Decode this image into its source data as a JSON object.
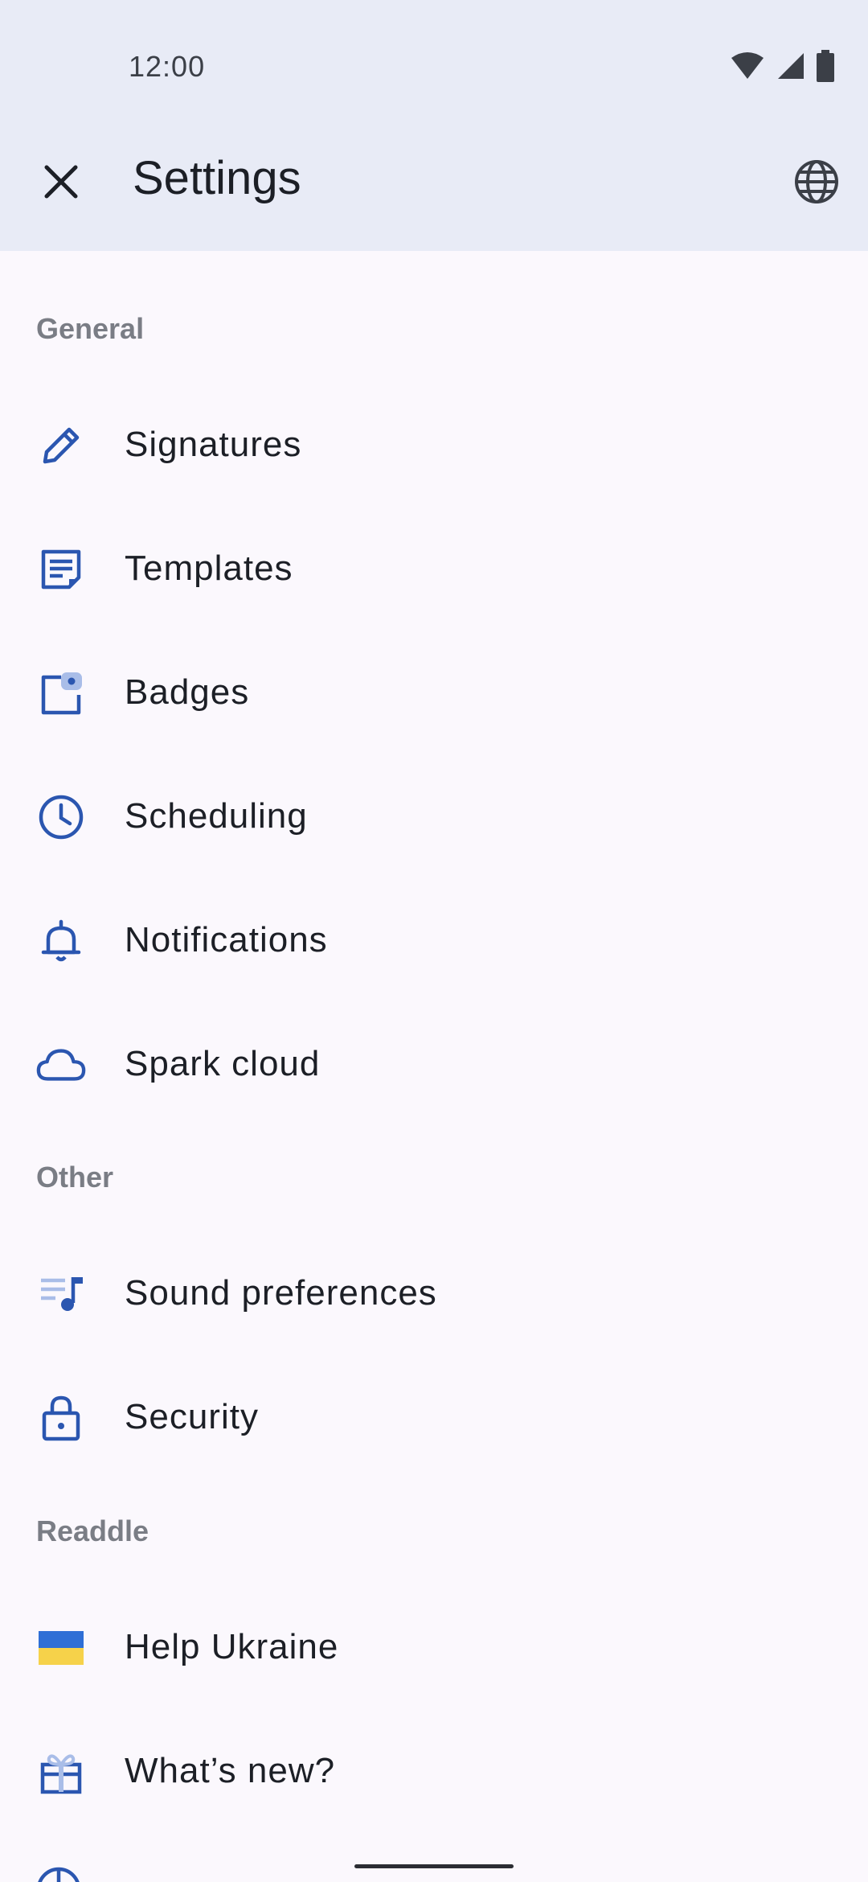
{
  "status": {
    "time": "12:00"
  },
  "header": {
    "title": "Settings"
  },
  "sections": {
    "general": "General",
    "other": "Other",
    "readdle": "Readdle"
  },
  "items": {
    "signatures": "Signatures",
    "templates": "Templates",
    "badges": "Badges",
    "scheduling": "Scheduling",
    "notifications": "Notifications",
    "spark_cloud": "Spark cloud",
    "sound_preferences": "Sound preferences",
    "security": "Security",
    "help_ukraine": "Help Ukraine",
    "whats_new": "What’s new?"
  },
  "icons": {
    "signatures": "pencil-icon",
    "templates": "document-icon",
    "badges": "badge-icon",
    "scheduling": "clock-icon",
    "notifications": "bell-icon",
    "spark_cloud": "cloud-icon",
    "sound_preferences": "music-list-icon",
    "security": "lock-icon",
    "help_ukraine": "ukraine-flag-icon",
    "whats_new": "gift-icon"
  },
  "colors": {
    "accent": "#2b56b0",
    "accent_light": "#a9bde8",
    "header_bg": "#e8ebf6",
    "page_bg": "#fbf8fd"
  }
}
